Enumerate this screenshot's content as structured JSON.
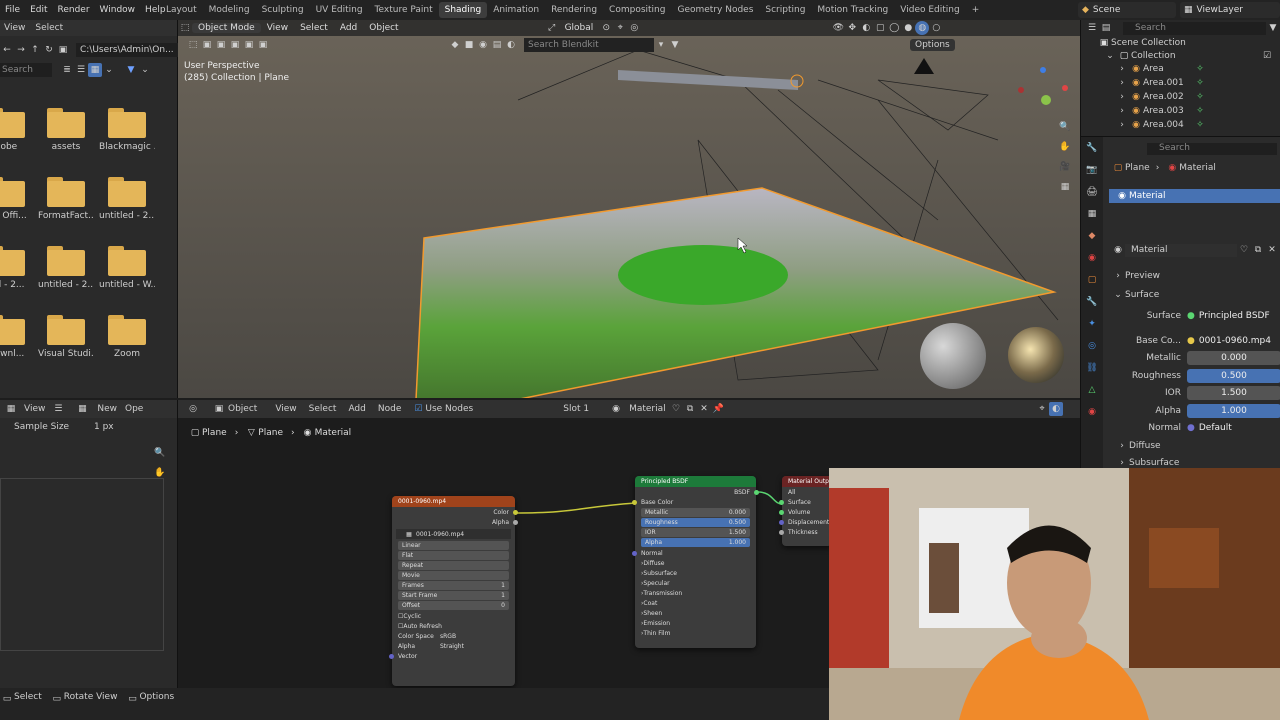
{
  "topbar": {
    "menus": [
      "File",
      "Edit",
      "Render",
      "Window",
      "Help"
    ],
    "workspaces": [
      "Layout",
      "Modeling",
      "Sculpting",
      "UV Editing",
      "Texture Paint",
      "Shading",
      "Animation",
      "Rendering",
      "Compositing",
      "Geometry Nodes",
      "Scripting",
      "Motion Tracking",
      "Video Editing"
    ],
    "active_workspace": "Shading",
    "add_tab": "+",
    "scene": "Scene",
    "view_layer": "ViewLayer"
  },
  "file_browser": {
    "header": [
      "View",
      "Select"
    ],
    "path": "C:\\Users\\Admin\\On...",
    "search_placeholder": "Search",
    "folders": [
      "dobe",
      "assets",
      "Blackmagic ...",
      "om Offi...",
      "FormatFact...",
      "untitled - 2...",
      "led - 2...",
      "untitled - 2...",
      "untitled - W...",
      "Downl...",
      "Visual Studi...",
      "Zoom"
    ]
  },
  "viewport": {
    "mode": "Object Mode",
    "menus": [
      "View",
      "Select",
      "Add",
      "Object"
    ],
    "orientation": "Global",
    "info_line1": "User Perspective",
    "info_line2": "(285) Collection | Plane",
    "options": "Options",
    "search_placeholder": "Search Blendkit"
  },
  "outliner": {
    "search_placeholder": "Search",
    "title": "Scene Collection",
    "collection": "Collection",
    "items": [
      "Area",
      "Area.001",
      "Area.002",
      "Area.003",
      "Area.004"
    ]
  },
  "properties": {
    "search_placeholder": "Search",
    "breadcrumb_object": "Plane",
    "breadcrumb_data": "Material",
    "slot_material": "Material",
    "material_name": "Material",
    "preview": "Preview",
    "surface_panel": "Surface",
    "surface_label": "Surface",
    "surface_value": "Principled BSDF",
    "base_color_label": "Base Co...",
    "base_color_value": "0001-0960.mp4",
    "metallic_label": "Metallic",
    "metallic_value": "0.000",
    "roughness_label": "Roughness",
    "roughness_value": "0.500",
    "ior_label": "IOR",
    "ior_value": "1.500",
    "alpha_label": "Alpha",
    "alpha_value": "1.000",
    "normal_label": "Normal",
    "normal_value": "Default",
    "diffuse": "Diffuse",
    "subsurface": "Subsurface"
  },
  "left_bottom": {
    "menus": [
      "View",
      "New",
      "Ope"
    ],
    "sample_size_label": "Sample Size",
    "sample_size_value": "1 px"
  },
  "node_editor": {
    "object_label": "Object",
    "menus": [
      "View",
      "Select",
      "Add",
      "Node"
    ],
    "use_nodes": "Use Nodes",
    "slot": "Slot 1",
    "material": "Material",
    "breadcrumb": [
      "Plane",
      "Plane",
      "Material"
    ],
    "image_node": {
      "title": "0001-0960.mp4",
      "out_color": "Color",
      "out_alpha": "Alpha",
      "image_name": "0001-0960.mp4",
      "interpolation": "Linear",
      "projection": "Flat",
      "extension": "Repeat",
      "source": "Movie",
      "frames_label": "Frames",
      "frames_value": "1",
      "start_label": "Start Frame",
      "start_value": "1",
      "offset_label": "Offset",
      "offset_value": "0",
      "cyclic": "Cyclic",
      "auto_refresh": "Auto Refresh",
      "color_space_label": "Color Space",
      "color_space_value": "sRGB",
      "alpha_label": "Alpha",
      "alpha_value": "Straight",
      "vector": "Vector"
    },
    "bsdf_node": {
      "title": "Principled BSDF",
      "out": "BSDF",
      "base_color": "Base Color",
      "metallic": "Metallic",
      "metallic_value": "0.000",
      "roughness": "Roughness",
      "roughness_value": "0.500",
      "ior": "IOR",
      "ior_value": "1.500",
      "alpha": "Alpha",
      "alpha_value": "1.000",
      "normal": "Normal",
      "panels": [
        "Diffuse",
        "Subsurface",
        "Specular",
        "Transmission",
        "Coat",
        "Sheen",
        "Emission",
        "Thin Film"
      ]
    },
    "output_node": {
      "title": "Material Outp...",
      "target": "All",
      "inputs": [
        "Surface",
        "Volume",
        "Displacement",
        "Thickness"
      ]
    }
  },
  "statusbar": {
    "items": [
      "Select",
      "Rotate View",
      "Options"
    ]
  },
  "colors": {
    "accent_blue": "#4772b3",
    "shader_header": "#1d7a3a",
    "texture_header": "#a0431b",
    "output_header": "#6a2323",
    "selection_orange": "#f29a2e",
    "folder": "#e4b659"
  }
}
